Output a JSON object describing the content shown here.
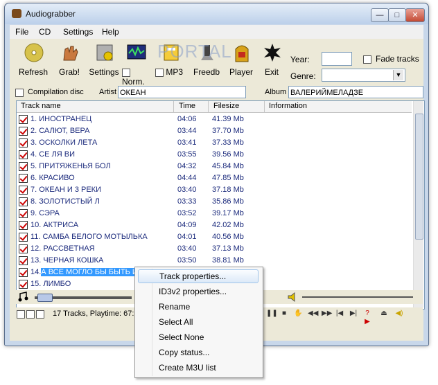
{
  "window": {
    "title": "Audiograbber"
  },
  "menu": [
    "File",
    "CD",
    "Settings",
    "Help"
  ],
  "toolbar": {
    "refresh": "Refresh",
    "grab": "Grab!",
    "settings": "Settings",
    "norm": "Norm.",
    "mp3": "MP3",
    "freedb": "Freedb",
    "player": "Player",
    "exit": "Exit",
    "year_label": "Year:",
    "genre_label": "Genre:",
    "fade_label": "Fade tracks",
    "year_value": "",
    "genre_value": ""
  },
  "watermark": "PORTAL",
  "info": {
    "compilation_label": "Compilation disc",
    "artist_label": "Artist",
    "artist_value": "ОКЕАН",
    "album_label": "Album",
    "album_value": "ВАЛЕРИЙМЕЛАДЗЕ"
  },
  "columns": {
    "name": "Track name",
    "time": "Time",
    "size": "Filesize",
    "info": "Information"
  },
  "tracks": [
    {
      "name": "1. ИНОСТРАНЕЦ",
      "time": "04:06",
      "size": "41.39 Mb"
    },
    {
      "name": "2. САЛЮТ, ВЕРА",
      "time": "03:44",
      "size": "37.70 Mb"
    },
    {
      "name": "3. ОСКОЛКИ ЛЕТА",
      "time": "03:41",
      "size": "37.33 Mb"
    },
    {
      "name": "4. СЕ ЛЯ ВИ",
      "time": "03:55",
      "size": "39.56 Mb"
    },
    {
      "name": "5. ПРИТЯЖЕНЬЯ БОЛ",
      "time": "04:32",
      "size": "45.84 Mb"
    },
    {
      "name": "6. КРАСИВО",
      "time": "04:44",
      "size": "47.85 Mb"
    },
    {
      "name": "7. ОКЕАН И 3 РЕКИ",
      "time": "03:40",
      "size": "37.18 Mb"
    },
    {
      "name": "8. ЗОЛОТИСТЫЙ Л",
      "time": "03:33",
      "size": "35.86 Mb"
    },
    {
      "name": "9. СЭРА",
      "time": "03:52",
      "size": "39.17 Mb"
    },
    {
      "name": "10. АКТРИСА",
      "time": "04:09",
      "size": "42.02 Mb"
    },
    {
      "name": "11. САМБА БЕЛОГО МОТЫЛЬКА",
      "time": "04:01",
      "size": "40.56 Mb"
    },
    {
      "name": "12. РАССВЕТНАЯ",
      "time": "03:40",
      "size": "37.13 Mb"
    },
    {
      "name": "13. ЧЕРНАЯ КОШКА",
      "time": "03:50",
      "size": "38.81 Mb"
    },
    {
      "name_prefix": "14.",
      "name": "А ВСЕ МОГЛО БЫ БЫТЬ И",
      "time": "",
      "size": ""
    },
    {
      "name": "15. ЛИМБО",
      "time": "",
      "size": ""
    }
  ],
  "status": {
    "text": "17 Tracks,  Playtime: 67:"
  },
  "context_menu": [
    "Track properties...",
    "ID3v2 properties...",
    "Rename",
    "Select All",
    "Select None",
    "Copy status...",
    "Create M3U list"
  ]
}
